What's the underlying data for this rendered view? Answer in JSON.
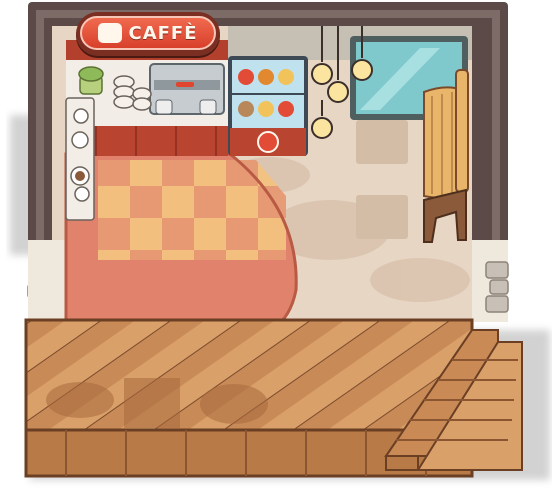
{
  "sign": {
    "text": "CAFFÈ"
  },
  "icons": [
    "coffee-cup-icon",
    "pastry-icon",
    "hanging-lamp-icon",
    "mug-icon"
  ],
  "colors": {
    "wall": "#5b4a48",
    "wall_inner": "#7d6b67",
    "floor": "#e8d6c4",
    "rug": "#e1826c",
    "checker_light": "#f5d28a",
    "deck": "#c98a55",
    "sign_red": "#d8402b",
    "glass": "#7fc9cc"
  }
}
